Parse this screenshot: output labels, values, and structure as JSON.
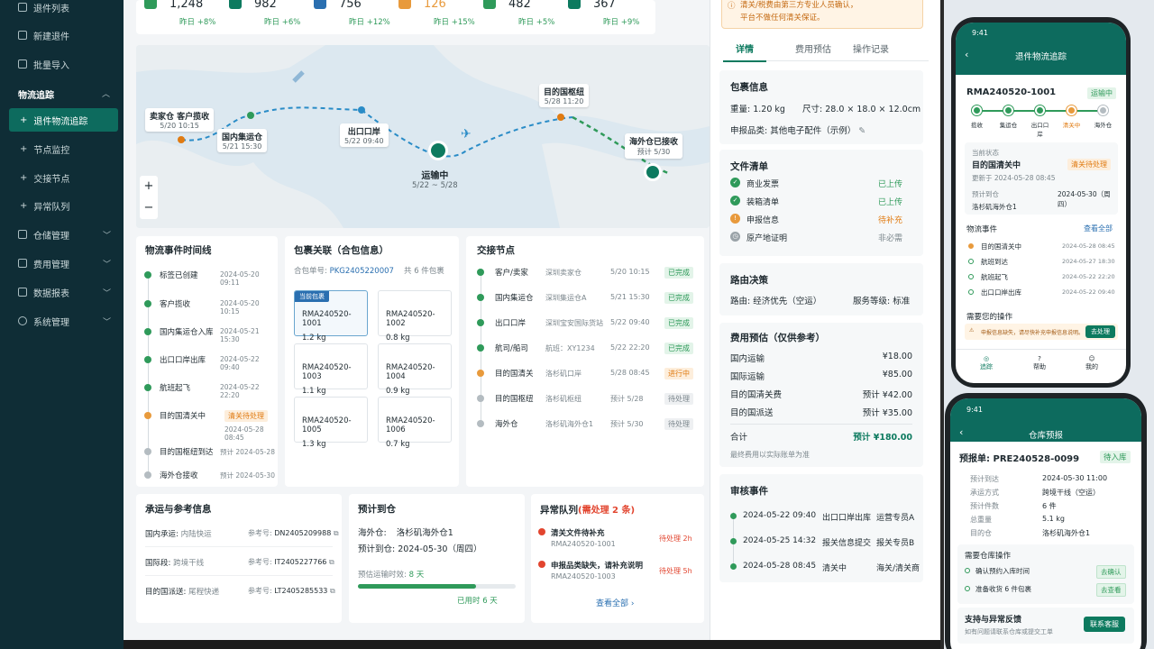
{
  "sidebar": {
    "top_item": "退件列表",
    "items": [
      {
        "label": "新建退件"
      },
      {
        "label": "批量导入"
      }
    ],
    "group": "物流追踪",
    "active": "退件物流追踪",
    "subs": [
      "节点监控",
      "交接节点",
      "异常队列"
    ],
    "groups": [
      "仓储管理",
      "费用管理",
      "数据报表",
      "系统管理"
    ]
  },
  "stats": [
    {
      "value": "1,248",
      "delta": "昨日 +8%"
    },
    {
      "value": "982",
      "delta": "昨日 +6%"
    },
    {
      "value": "756",
      "delta": "昨日 +12%"
    },
    {
      "value": "126",
      "delta": "昨日 +15%"
    },
    {
      "value": "482",
      "delta": "昨日 +5%"
    },
    {
      "value": "367",
      "delta": "昨日 +9%"
    }
  ],
  "map": {
    "n1": "卖家仓 客户揽收",
    "n1t": "5/20 10:15",
    "n2": "国内集运仓",
    "n2t": "5/21 15:30",
    "n3": "出口口岸",
    "n3t": "5/22 09:40",
    "n4": "运输中",
    "n4t": "5/22 ~ 5/28",
    "n5": "目的国枢纽",
    "n5t": "5/28 11:20",
    "n6": "海外仓已接收",
    "n6t": "预计 5/30",
    "zoom_in": "+",
    "zoom_out": "−"
  },
  "timeline": {
    "title": "物流事件时间线",
    "events": [
      {
        "name": "标签已创建",
        "time": "2024-05-20 09:11"
      },
      {
        "name": "客户揽收",
        "time": "2024-05-20 10:15"
      },
      {
        "name": "国内集运仓入库",
        "time": "2024-05-21 15:30"
      },
      {
        "name": "出口口岸出库",
        "time": "2024-05-22 09:40"
      },
      {
        "name": "航班起飞",
        "time": "2024-05-22 22:20"
      },
      {
        "name": "目的国清关中",
        "badge": "清关待处理",
        "time": "2024-05-28 08:45"
      },
      {
        "name": "目的国枢纽到达",
        "time": "预计 2024-05-28"
      },
      {
        "name": "海外仓接收",
        "time": "预计 2024-05-30"
      }
    ]
  },
  "packages": {
    "title": "包裹关联（合包信息）",
    "order_label": "合包单号:",
    "order_no": "PKG2405220007",
    "count": "共 6 件包裹",
    "current_tag": "当前包裹",
    "items": [
      {
        "id": "RMA240520-1001",
        "w": "1.2 kg"
      },
      {
        "id": "RMA240520-1002",
        "w": "0.8 kg"
      },
      {
        "id": "RMA240520-1003",
        "w": "1.1 kg"
      },
      {
        "id": "RMA240520-1004",
        "w": "0.9 kg"
      },
      {
        "id": "RMA240520-1005",
        "w": "1.3 kg"
      },
      {
        "id": "RMA240520-1006",
        "w": "0.7 kg"
      }
    ]
  },
  "handover": {
    "title": "交接节点",
    "rows": [
      {
        "name": "客户/卖家",
        "place": "深圳卖家仓",
        "time": "5/20 10:15",
        "status": "已完成"
      },
      {
        "name": "国内集运仓",
        "place": "深圳集运仓A",
        "time": "5/21 15:30",
        "status": "已完成"
      },
      {
        "name": "出口口岸",
        "place": "深圳宝安国际货站",
        "time": "5/22 09:40",
        "status": "已完成"
      },
      {
        "name": "航司/船司",
        "place": "航班：XY1234",
        "time": "5/22 22:20",
        "status": "已完成"
      },
      {
        "name": "目的国清关",
        "place": "洛杉矶口岸",
        "time": "5/28 08:45",
        "status": "进行中"
      },
      {
        "name": "目的国枢纽",
        "place": "洛杉矶枢纽",
        "time": "预计 5/28",
        "status": "待处理"
      },
      {
        "name": "海外仓",
        "place": "洛杉矶海外仓1",
        "time": "预计 5/30",
        "status": "待处理"
      }
    ]
  },
  "carrier": {
    "title": "承运与参考信息",
    "ref": "参考号:",
    "rows": [
      {
        "label": "国内承运:",
        "val": "内陆快运",
        "no": "DN2405209988"
      },
      {
        "label": "国际段:",
        "val": "跨境干线",
        "no": "IT2405227766"
      },
      {
        "label": "目的国派送:",
        "val": "尾程快递",
        "no": "LT2405285533"
      }
    ]
  },
  "eta": {
    "title": "预计到仓",
    "wh_label": "海外仓:",
    "wh": "洛杉矶海外仓1",
    "date_label": "预计到仓:",
    "date": "2024-05-30（周四）",
    "lead_label": "预估运输时效:",
    "lead": "8 天",
    "progress": 0.75,
    "used": "已用时 6 天"
  },
  "exceptions": {
    "title": "异常队列",
    "count": "(需处理 2 条)",
    "items": [
      {
        "name": "清关文件待补充",
        "id": "RMA240520-1001",
        "state": "待处理 2h"
      },
      {
        "name": "申报品类缺失，请补充说明",
        "id": "RMA240520-1003",
        "state": "待处理 5h"
      }
    ],
    "more": "查看全部 ›"
  },
  "right": {
    "notice1": "清关/税费由第三方专业人员确认，",
    "notice2": "平台不做任何清关保证。",
    "tabs": [
      "详情",
      "费用预估",
      "操作记录"
    ],
    "pkg_title": "包裹信息",
    "weight_label": "重量:",
    "weight": "1.20 kg",
    "size_label": "尺寸:",
    "size": "28.0 × 18.0 × 12.0cm",
    "cat_label": "申报品类:",
    "cat": "其他电子配件（示例）",
    "docs_title": "文件清单",
    "docs": [
      {
        "name": "商业发票",
        "state": "已上传"
      },
      {
        "name": "装箱清单",
        "state": "已上传"
      },
      {
        "name": "申报信息",
        "state": "待补充"
      },
      {
        "name": "原产地证明",
        "state": "非必需"
      }
    ],
    "route_title": "路由决策",
    "route_label": "路由:",
    "route": "经济优先（空运）",
    "svc_label": "服务等级:",
    "svc": "标准",
    "fee_title": "费用预估（仅供参考）",
    "fees": [
      {
        "name": "国内运输",
        "val": "¥18.00"
      },
      {
        "name": "国际运输",
        "val": "¥85.00"
      },
      {
        "name": "目的国清关费",
        "val": "预计 ¥42.00"
      },
      {
        "name": "目的国派送",
        "val": "预计 ¥35.00"
      }
    ],
    "total_label": "合计",
    "total": "预计 ¥180.00",
    "total_note": "最终费用以实际账单为准",
    "audit_title": "审核事件",
    "audits": [
      {
        "time": "2024-05-22 09:40",
        "act": "出口口岸出库",
        "who": "运营专员A"
      },
      {
        "time": "2024-05-25 14:32",
        "act": "报关信息提交",
        "who": "报关专员B"
      },
      {
        "time": "2024-05-28 08:45",
        "act": "清关中",
        "who": "海关/清关商"
      }
    ]
  },
  "phone1": {
    "time": "9:41",
    "title": "退件物流追踪",
    "rma": "RMA240520-1001",
    "status": "运输中",
    "steps": [
      "揽收",
      "集运仓",
      "出口口岸",
      "清关中",
      "海外仓"
    ],
    "cur_label": "当前状态",
    "cur": "目的国清关中",
    "cur_badge": "清关待处理",
    "updated": "更新于 2024-05-28 08:45",
    "eta_label": "预计到仓",
    "eta": "2024-05-30（周四）",
    "wh": "洛杉矶海外仓1",
    "ev_title": "物流事件",
    "ev_all": "查看全部",
    "events": [
      {
        "n": "目的国清关中",
        "t": "2024-05-28 08:45"
      },
      {
        "n": "航班到达",
        "t": "2024-05-27 18:30"
      },
      {
        "n": "航班起飞",
        "t": "2024-05-22 22:20"
      },
      {
        "n": "出口口岸出库",
        "t": "2024-05-22 09:40"
      }
    ],
    "op_title": "需要您的操作",
    "op": "申报信息缺失，请尽快补充申报信息说明。",
    "op_btn": "去处理",
    "nav": [
      "追踪",
      "帮助",
      "我的"
    ]
  },
  "phone2": {
    "time": "9:41",
    "title": "仓库预报",
    "pre_label": "预报单:",
    "pre": "PRE240528-0099",
    "badge": "待入库",
    "rows": [
      {
        "l": "预计到达",
        "v": "2024-05-30 11:00"
      },
      {
        "l": "承运方式",
        "v": "跨境干线（空运）"
      },
      {
        "l": "预计件数",
        "v": "6 件"
      },
      {
        "l": "总重量",
        "v": "5.1 kg"
      },
      {
        "l": "目的仓",
        "v": "洛杉矶海外仓1"
      }
    ],
    "ops_title": "需要仓库操作",
    "ops": [
      {
        "n": "确认预约入库时间",
        "b": "去确认"
      },
      {
        "n": "准备收货 6 件包裹",
        "b": "去查看"
      }
    ],
    "sup_title": "支持与异常反馈",
    "sup": "如有问题请联系仓库或提交工单",
    "sup_btn": "联系客服"
  }
}
